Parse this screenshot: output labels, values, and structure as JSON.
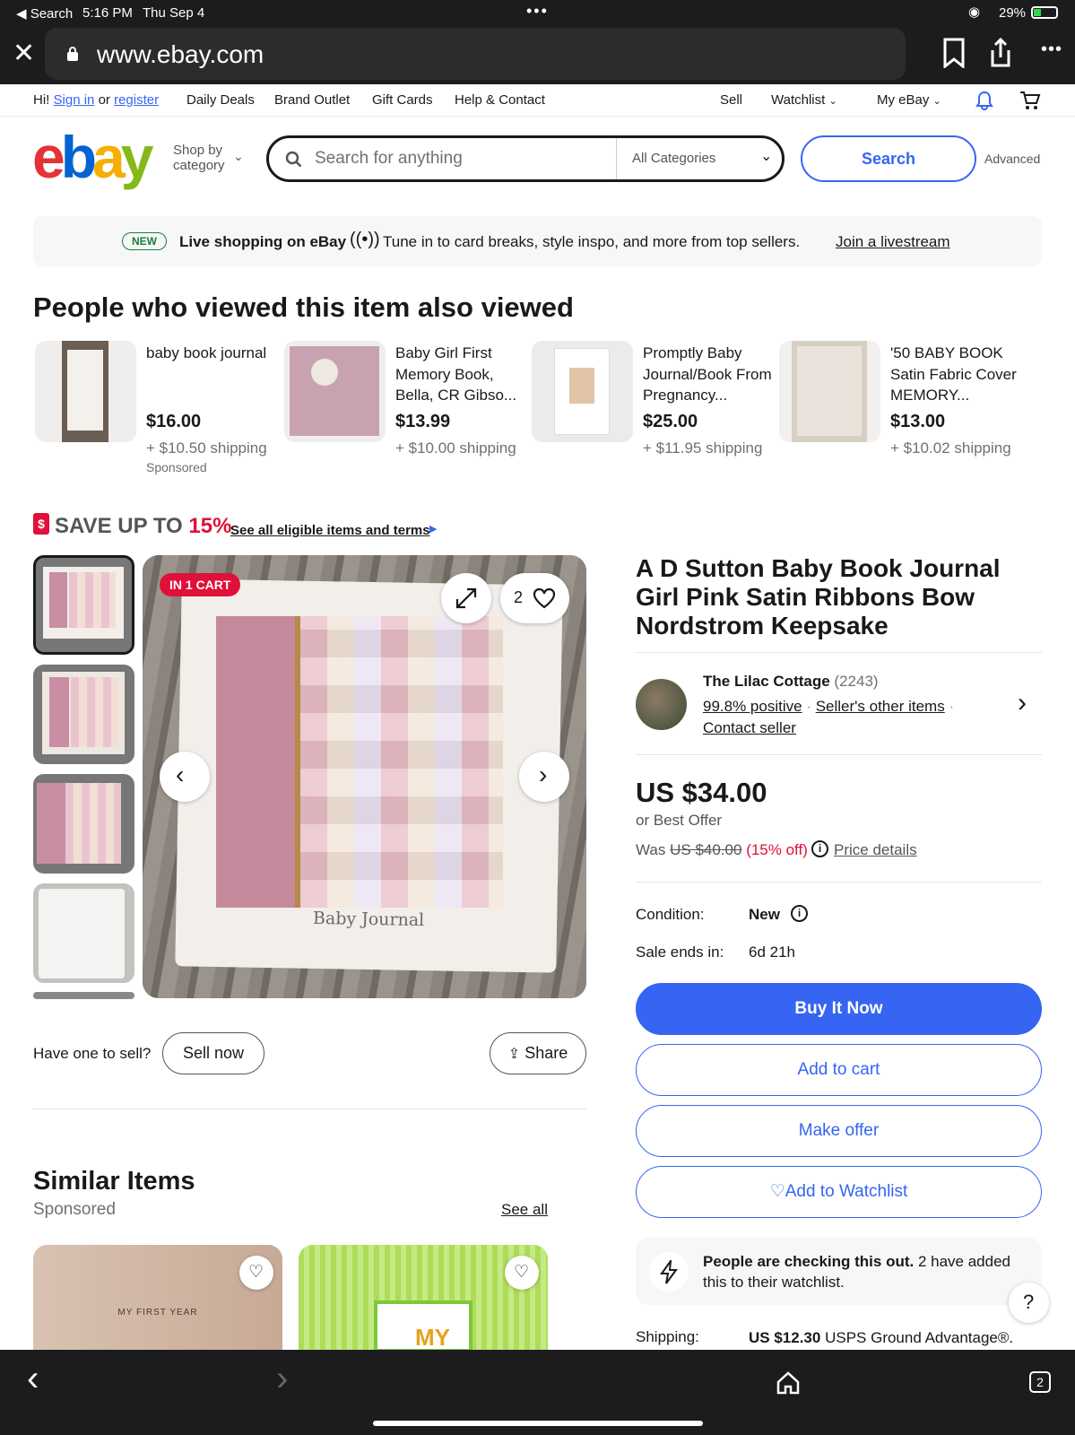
{
  "status_bar": {
    "back": "◀ Search",
    "time": "5:16 PM",
    "date": "Thu Sep 4",
    "battery": "29%"
  },
  "browser": {
    "url": "www.ebay.com"
  },
  "top_nav": {
    "greeting": "Hi!",
    "sign_in": "Sign in",
    "or": "or",
    "register": "register",
    "links": [
      "Daily Deals",
      "Brand Outlet",
      "Gift Cards",
      "Help & Contact"
    ],
    "sell": "Sell",
    "watchlist": "Watchlist",
    "my_ebay": "My eBay"
  },
  "header": {
    "shop_by": "Shop by",
    "category": "category",
    "search_placeholder": "Search for anything",
    "categories_select": "All Categories",
    "search_button": "Search",
    "advanced": "Advanced"
  },
  "banner": {
    "badge": "NEW",
    "title": "Live shopping on eBay",
    "text": "Tune in to card breaks, style inspo, and more from top sellers.",
    "link": "Join a livestream"
  },
  "also_viewed": {
    "heading": "People who viewed this item also viewed",
    "items": [
      {
        "title": "baby book journal",
        "price": "$16.00",
        "shipping": "+ $10.50 shipping",
        "sponsored": "Sponsored"
      },
      {
        "title": "Baby Girl First Memory Book, Bella, CR Gibso...",
        "price": "$13.99",
        "shipping": "+ $10.00 shipping"
      },
      {
        "title": "Promptly Baby Journal/Book From Pregnancy...",
        "price": "$25.00",
        "shipping": "+ $11.95 shipping"
      },
      {
        "title": "'50 BABY BOOK Satin Fabric Cover MEMORY...",
        "price": "$13.00",
        "shipping": "+ $10.02 shipping"
      }
    ]
  },
  "promo": {
    "save": "SAVE UP TO",
    "percent": "15%",
    "link": "See all eligible items and terms"
  },
  "gallery": {
    "badge": "IN 1 CART",
    "watch_count": "2",
    "image_caption": "Baby Journal"
  },
  "sell_row": {
    "prompt": "Have one to sell?",
    "sell_now": "Sell now",
    "share": "Share"
  },
  "similar": {
    "heading": "Similar Items",
    "sponsored": "Sponsored",
    "see_all": "See all",
    "item1_text": "MY FIRST YEAR",
    "item2_text": "MY"
  },
  "listing": {
    "title": "A D Sutton Baby Book Journal Girl Pink Satin Ribbons Bow Nordstrom Keepsake",
    "seller_name": "The Lilac Cottage",
    "seller_count": "(2243)",
    "positive": "99.8% positive",
    "other_items": "Seller's other items",
    "contact": "Contact seller",
    "price": "US $34.00",
    "best_offer": "or Best Offer",
    "was_label": "Was",
    "was_price": "US $40.00",
    "discount": "(15% off)",
    "price_details": "Price details",
    "condition_label": "Condition:",
    "condition_value": "New",
    "sale_ends_label": "Sale ends in:",
    "sale_ends_value": "6d 21h",
    "buy_now": "Buy It Now",
    "add_to_cart": "Add to cart",
    "make_offer": "Make offer",
    "add_watchlist": "Add to Watchlist",
    "checking_bold": "People are checking this out.",
    "checking_text": " 2 have added this to their watchlist.",
    "shipping_label": "Shipping:",
    "shipping_price": "US $12.30",
    "shipping_method": "USPS Ground Advantage",
    "shipping_suffix": "®."
  },
  "help": "?",
  "tab_count": "2",
  "colors": {
    "accent": "#3665f3",
    "red": "#e0103a",
    "ebay_e": "#e53238",
    "ebay_b": "#0064d2",
    "ebay_a": "#f5af02",
    "ebay_y": "#86b817"
  }
}
